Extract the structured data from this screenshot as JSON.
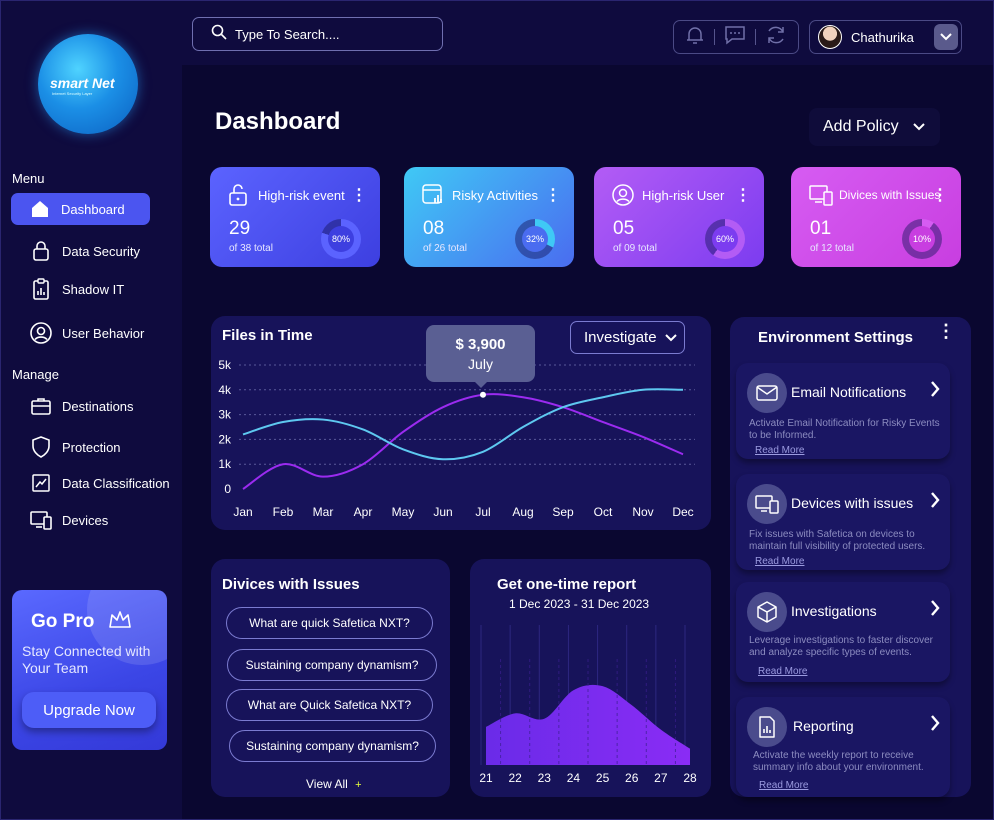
{
  "brand": {
    "name": "smart Net",
    "tagline": "Internet Security Layer"
  },
  "search": {
    "placeholder": "Type To Search...."
  },
  "user": {
    "name": "Chathurika"
  },
  "sidebar": {
    "menu_label": "Menu",
    "manage_label": "Manage",
    "menu_items": [
      {
        "label": "Dashboard",
        "icon": "home-icon",
        "active": true
      },
      {
        "label": "Data Security",
        "icon": "lock-icon"
      },
      {
        "label": "Shadow IT",
        "icon": "clipboard-chart-icon"
      },
      {
        "label": "User Behavior",
        "icon": "user-circle-icon"
      }
    ],
    "manage_items": [
      {
        "label": "Destinations",
        "icon": "briefcase-icon"
      },
      {
        "label": "Protection",
        "icon": "shield-icon"
      },
      {
        "label": "Data Classification",
        "icon": "chart-line-icon"
      },
      {
        "label": "Devices",
        "icon": "devices-icon"
      }
    ],
    "gopro": {
      "title": "Go Pro",
      "subtitle": "Stay Connected with Your Team",
      "button": "Upgrade Now"
    }
  },
  "page": {
    "title": "Dashboard",
    "add_policy": "Add Policy"
  },
  "stats": [
    {
      "title": "High-risk event",
      "value": "29",
      "total": "of 38 total",
      "percent": "80%",
      "fraction": 0.8,
      "icon": "unlock-icon",
      "colors": [
        "#5b63ff",
        "#3d3fe0"
      ]
    },
    {
      "title": "Risky Activities",
      "value": "08",
      "total": "of 26 total",
      "percent": "32%",
      "fraction": 0.32,
      "icon": "report-icon",
      "colors": [
        "#3fc9f5",
        "#4a6cf0"
      ]
    },
    {
      "title": "High-risk User",
      "value": "05",
      "total": "of 09 total",
      "percent": "60%",
      "fraction": 0.6,
      "icon": "user-circle-icon",
      "colors": [
        "#b35cf5",
        "#7c3cf0"
      ]
    },
    {
      "title": "Divices with  Issues",
      "value": "01",
      "total": "of 12 total",
      "percent": "10%",
      "fraction": 0.1,
      "icon": "devices-icon",
      "colors": [
        "#d65cf2",
        "#c83ee0"
      ]
    }
  ],
  "files_chart": {
    "title": "Files in Time",
    "dropdown": "Investigate",
    "tooltip": {
      "value": "$ 3,900",
      "label": "July"
    }
  },
  "chart_data": [
    {
      "type": "line",
      "title": "Files in Time",
      "categories": [
        "Jan",
        "Feb",
        "Mar",
        "Apr",
        "May",
        "Jun",
        "Jul",
        "Aug",
        "Sep",
        "Oct",
        "Nov",
        "Dec"
      ],
      "y_ticks": [
        "0",
        "1k",
        "2k",
        "3k",
        "4k",
        "5k"
      ],
      "ylim": [
        0,
        5000
      ],
      "grid": true,
      "series": [
        {
          "color": "#9b2bf0",
          "values": [
            0,
            1000,
            500,
            1000,
            2300,
            3300,
            3800,
            3700,
            3300,
            2700,
            2100,
            1400
          ]
        },
        {
          "color": "#5ec8f0",
          "values": [
            2200,
            2700,
            2800,
            2400,
            1600,
            1200,
            1500,
            2500,
            3300,
            3700,
            4000,
            4000
          ]
        }
      ]
    },
    {
      "type": "area",
      "title": "Get one-time report",
      "subtitle": "1 Dec 2023 - 31 Dec 2023",
      "categories": [
        "21",
        "22",
        "23",
        "24",
        "25",
        "26",
        "27",
        "28"
      ],
      "values": [
        28,
        38,
        34,
        55,
        58,
        44,
        26,
        12
      ],
      "ylim": [
        0,
        100
      ]
    }
  ],
  "devices_issues": {
    "title": "Divices with Issues",
    "items": [
      "What are quick Safetica NXT?",
      "Sustaining company dynamism?",
      "What are Quick Safetica NXT?",
      "Sustaining company dynamism?"
    ],
    "view_all": "View All",
    "view_all_icon": "+"
  },
  "env": {
    "title": "Environment Settings",
    "items": [
      {
        "title": "Email Notifications",
        "icon": "mail-icon",
        "desc": "Activate Email Notification  for Risky Events to be Informed.",
        "link": "Read More"
      },
      {
        "title": "Devices with issues",
        "icon": "devices-icon",
        "desc": "Fix issues with Safetica on devices to maintain full visibility of protected users.",
        "link": "Read More"
      },
      {
        "title": "Investigations",
        "icon": "cube-icon",
        "desc": "Leverage investigations to faster discover and analyze specific types of events.",
        "link": "Read More"
      },
      {
        "title": "Reporting",
        "icon": "report-doc-icon",
        "desc": "Activate the weekly report to receive summary info about your environment.",
        "link": "Read More"
      }
    ]
  }
}
